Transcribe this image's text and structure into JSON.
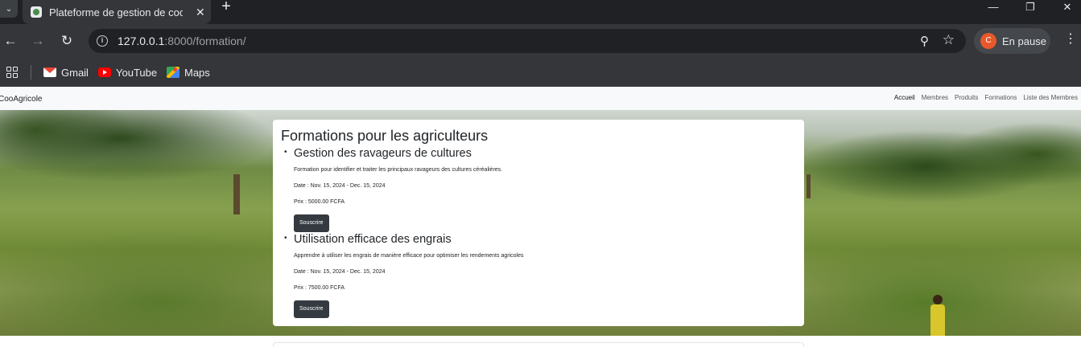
{
  "browser": {
    "tab_menu_icon": "chevron-down-icon",
    "tab_title": "Plateforme de gestion de coopé",
    "tab_close": "✕",
    "new_tab": "+",
    "window_controls": {
      "minimize": "—",
      "restore": "❐",
      "close": "✕"
    },
    "nav": {
      "back": "←",
      "forward": "→",
      "reload": "↻"
    },
    "url_host": "127.0.0.1",
    "url_rest": ":8000/formation/",
    "profile": {
      "initial": "C",
      "label": "En pause"
    },
    "bookmarks": [
      "Gmail",
      "YouTube",
      "Maps"
    ]
  },
  "page": {
    "brand": "CooAgricole",
    "nav": {
      "home": "Accueil",
      "members": "Membres",
      "products": "Produits",
      "trainings": "Formations",
      "member_list": "Liste des Membres"
    },
    "heading": "Formations pour les agriculteurs",
    "formations": [
      {
        "title": "Gestion des ravageurs de cultures",
        "description": "Formation pour identifier et traiter les principaux ravageurs des cultures céréalières.",
        "date": "Date : Nov. 15, 2024 - Dec. 15, 2024",
        "price": "Prix : 5000.00 FCFA",
        "button": "Souscrire"
      },
      {
        "title": "Utilisation efficace des engrais",
        "description": "Apprendre à utiliser les engrais de manière efficace pour optimiser les rendements agricoles",
        "date": "Date : Nov. 15, 2024 - Dec. 15, 2024",
        "price": "Prix : 7500.00 FCFA",
        "button": "Souscrire"
      }
    ]
  }
}
